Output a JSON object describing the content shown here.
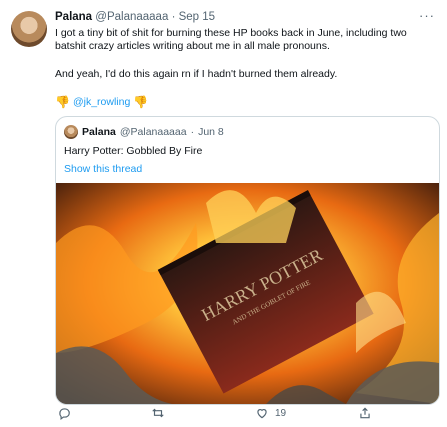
{
  "tweet": {
    "author_name": "Palana",
    "author_handle": "@Palanaaaaa",
    "separator": "·",
    "date": "Sep 15",
    "text_line1": "I got a tiny bit of shit for burning these HP books back in June, including two",
    "text_line2": "batshit crazy articles writing about me in all male pronouns.",
    "text_line3": "And yeah, I'd do this again rn if I hadn't burned them already.",
    "mention": "@jk_rowling",
    "more_label": "···"
  },
  "quote": {
    "author_name": "Palana",
    "author_handle": "@Palanaaaaa",
    "separator": "·",
    "date": "Jun 8",
    "text": "Harry Potter: Gobbled By Fire",
    "show_thread": "Show this thread",
    "book_title": "HARRY POTTER",
    "book_subtitle": "AND THE GOBLET OF FIRE"
  },
  "actions": {
    "reply_count": "",
    "retweet_count": "",
    "like_count": "19",
    "share_count": ""
  },
  "colors": {
    "accent": "#1d9bf0",
    "muted": "#536471",
    "border": "#cfd9de"
  }
}
